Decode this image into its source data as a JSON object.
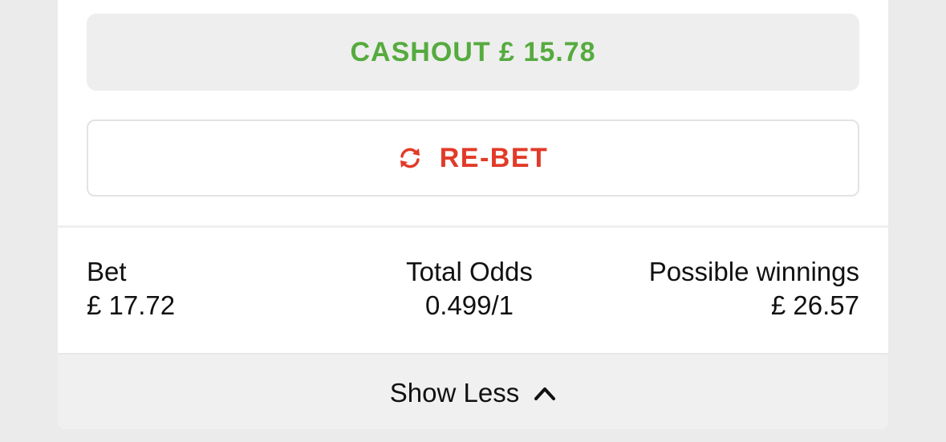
{
  "cashout": {
    "label": "CASHOUT £ 15.78",
    "color": "#55ab3e"
  },
  "rebet": {
    "label": "RE-BET",
    "icon": "refresh-icon",
    "color": "#e23a28"
  },
  "summary": {
    "bet": {
      "label": "Bet",
      "value": "£ 17.72"
    },
    "total_odds": {
      "label": "Total Odds",
      "value": "0.499/1"
    },
    "possible_winnings": {
      "label": "Possible winnings",
      "value": "£ 26.57"
    }
  },
  "footer": {
    "toggle_label": "Show Less",
    "icon": "chevron-up-icon"
  }
}
